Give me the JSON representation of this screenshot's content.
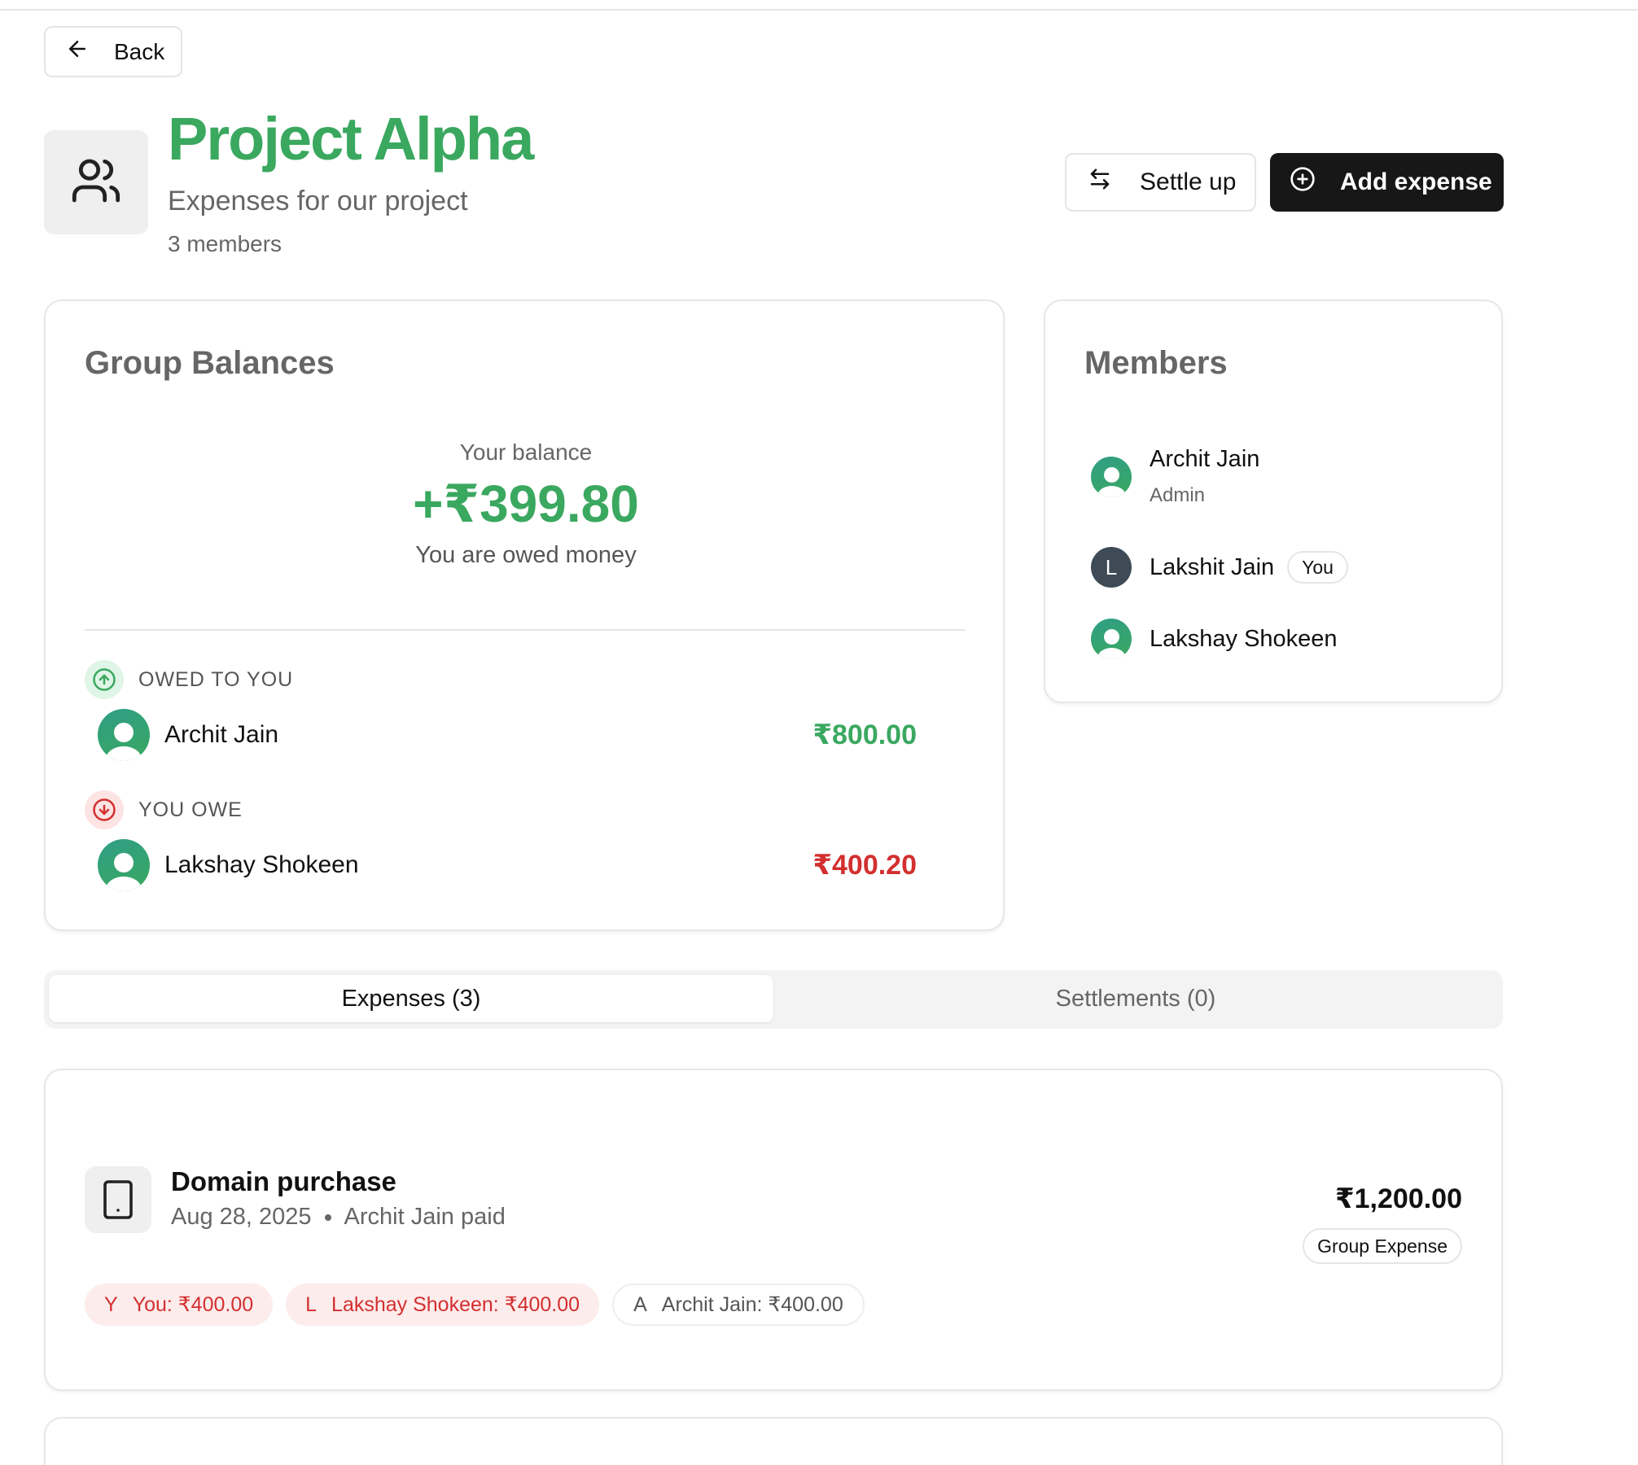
{
  "header": {
    "back_label": "Back",
    "title": "Project Alpha",
    "subtitle": "Expenses for our project",
    "members_count": "3 members",
    "settle_label": "Settle up",
    "add_expense_label": "Add expense"
  },
  "balances": {
    "title": "Group Balances",
    "your_balance_label": "Your balance",
    "your_balance_value": "+₹399.80",
    "your_balance_note": "You are owed money",
    "owed_to_you_label": "OWED TO YOU",
    "owed_to_you": [
      {
        "name": "Archit Jain",
        "amount": "₹800.00"
      }
    ],
    "you_owe_label": "YOU OWE",
    "you_owe": [
      {
        "name": "Lakshay Shokeen",
        "amount": "₹400.20"
      }
    ]
  },
  "members": {
    "title": "Members",
    "list": [
      {
        "name": "Archit Jain",
        "role": "Admin"
      },
      {
        "name": "Lakshit Jain",
        "initial": "L",
        "badge": "You"
      },
      {
        "name": "Lakshay Shokeen"
      }
    ]
  },
  "tabs": [
    {
      "label": "Expenses (3)",
      "active": true
    },
    {
      "label": "Settlements (0)",
      "active": false
    }
  ],
  "expenses": [
    {
      "title": "Domain purchase",
      "date": "Aug 28, 2025",
      "paid_by": "Archit Jain paid",
      "amount": "₹1,200.00",
      "type": "Group Expense",
      "splits": [
        {
          "initial": "Y",
          "label": "You: ₹400.00"
        },
        {
          "initial": "L",
          "label": "Lakshay Shokeen: ₹400.00"
        },
        {
          "initial": "A",
          "label": "Archit Jain: ₹400.00"
        }
      ]
    }
  ],
  "colors": {
    "brand_green": "#3aa85f",
    "debt_red": "#d32f2f",
    "primary_button": "#171717"
  },
  "icons": [
    "arrow-left-icon",
    "users-icon",
    "arrows-swap-icon",
    "plus-circle-icon",
    "arrow-up-circle-icon",
    "arrow-down-circle-icon",
    "user-avatar-icon",
    "tablet-icon"
  ]
}
